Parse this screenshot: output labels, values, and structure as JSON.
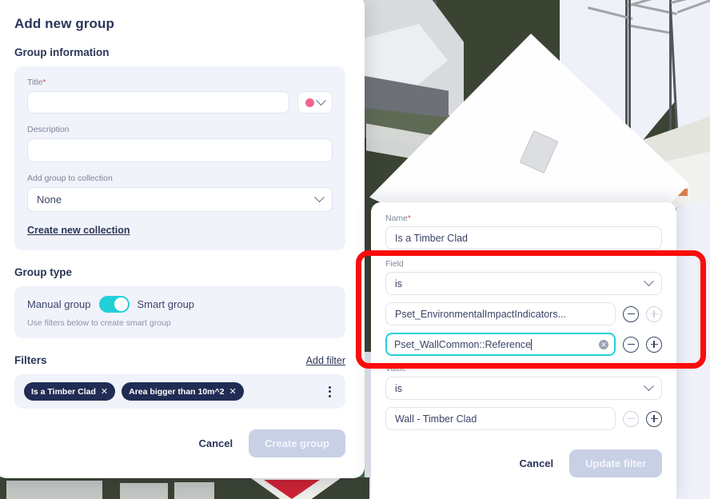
{
  "left_dialog": {
    "title": "Add new group",
    "group_information": {
      "heading": "Group information",
      "title_field": {
        "label": "Title",
        "required": "*",
        "value": "",
        "placeholder": ""
      },
      "color_picker": {
        "name": "color-swatch",
        "color": "#f0668c",
        "chevron": "chevron-down-icon"
      },
      "description_field": {
        "label": "Description",
        "value": "",
        "placeholder": ""
      },
      "collection_field": {
        "label": "Add group to collection",
        "value": "None"
      },
      "create_collection_link": "Create new collection"
    },
    "group_type": {
      "heading": "Group type",
      "left_label": "Manual group",
      "right_label": "Smart group",
      "toggle_state": "on",
      "toggle_color": "#22d0d8",
      "hint": "Use filters below to create smart group"
    },
    "filters": {
      "heading": "Filters",
      "add_filter_link": "Add filter",
      "chips": [
        {
          "label": "Is a Timber Clad",
          "remove": "✕"
        },
        {
          "label": "Area bigger than 10m^2",
          "remove": "✕"
        }
      ],
      "overflow_menu": "kebab-menu-icon"
    },
    "footer": {
      "cancel": "Cancel",
      "submit": "Create group",
      "submit_disabled": true
    }
  },
  "right_dialog": {
    "name_field": {
      "label": "Name",
      "required": "*",
      "value": "Is a Timber Clad"
    },
    "field_section": {
      "label": "Field",
      "operator": "is",
      "rows": [
        {
          "value": "Pset_EnvironmentalImpactIndicators...",
          "focused": false,
          "minus_enabled": true,
          "plus_enabled": false
        },
        {
          "value": "Pset_WallCommon::Reference",
          "focused": true,
          "minus_enabled": true,
          "plus_enabled": true,
          "clear_icon": "✕"
        }
      ]
    },
    "value_section": {
      "label": "Value",
      "operator": "is",
      "rows": [
        {
          "value": "Wall - Timber Clad",
          "focused": false,
          "minus_enabled": false,
          "plus_enabled": true
        }
      ]
    },
    "footer": {
      "cancel": "Cancel",
      "submit": "Update filter",
      "submit_disabled": true
    }
  },
  "annotation": {
    "type": "red-rectangle-highlight",
    "color": "#fb0b0b"
  },
  "viewport": {
    "description": "3D architectural model of a white house with dark green terrain",
    "ground_color": "#3b4433",
    "surround_color": "#477450",
    "sky_color": "#eef1f8"
  }
}
